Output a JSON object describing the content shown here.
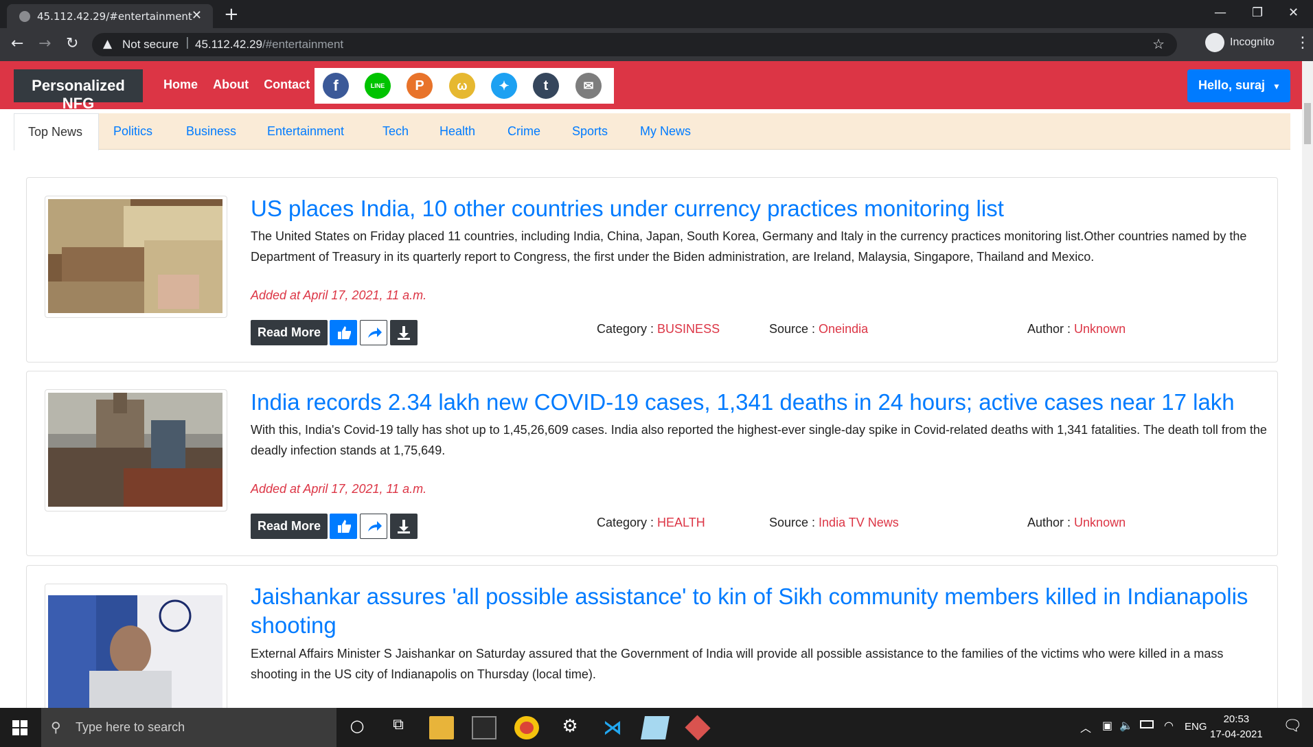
{
  "browser": {
    "tab_title": "45.112.42.29/#entertainment",
    "security_text": "Not secure",
    "url_host": "45.112.42.29",
    "url_path": "/#entertainment",
    "profile_label": "Incognito"
  },
  "navbar": {
    "brand": "Personalized NFG",
    "links": [
      "Home",
      "About",
      "Contact"
    ],
    "share_icons": [
      {
        "name": "facebook-icon",
        "glyph": "f",
        "color": "#3b5998"
      },
      {
        "name": "line-icon",
        "glyph": "LINE",
        "color": "#00c300"
      },
      {
        "name": "pinterest-icon",
        "glyph": "P",
        "color": "#e8732a"
      },
      {
        "name": "weibo-icon",
        "glyph": "w",
        "color": "#e6b830"
      },
      {
        "name": "twitter-icon",
        "glyph": "t",
        "color": "#1da1f2"
      },
      {
        "name": "tumblr-icon",
        "glyph": "t",
        "color": "#35465c"
      },
      {
        "name": "email-icon",
        "glyph": "✉",
        "color": "#7d7d7d"
      }
    ],
    "user_button": "Hello, suraj"
  },
  "categories": [
    "Top News",
    "Politics",
    "Business",
    "Entertainment",
    "Tech",
    "Health",
    "Crime",
    "Sports",
    "My News"
  ],
  "articles": [
    {
      "title": "US places India, 10 other countries under currency practices monitoring list",
      "description": "The United States on Friday placed 11 countries, including India, China, Japan, South Korea, Germany and Italy in the currency practices monitoring list.Other countries named by the Department of Treasury in its quarterly report to Congress, the first under the Biden administration, are Ireland, Malaysia, Singapore, Thailand and Mexico.",
      "added": "Added at April 17, 2021, 11 a.m.",
      "category": "BUSINESS",
      "source": "Oneindia",
      "author": "Unknown"
    },
    {
      "title": "India records 2.34 lakh new COVID-19 cases, 1,341 deaths in 24 hours; active cases near 17 lakh",
      "description": "With this, India's Covid-19 tally has shot up to 1,45,26,609 cases. India also reported the highest-ever single-day spike in Covid-related deaths with 1,341 fatalities. The death toll from the deadly infection stands at 1,75,649.",
      "added": "Added at April 17, 2021, 11 a.m.",
      "category": "HEALTH",
      "source": "India TV News",
      "author": "Unknown"
    },
    {
      "title": "Jaishankar assures 'all possible assistance' to kin of Sikh community members killed in Indianapolis shooting",
      "description": "External Affairs Minister S Jaishankar on Saturday assured that the Government of India will provide all possible assistance to the families of the victims who were killed in a mass shooting in the US city of Indianapolis on Thursday (local time)."
    }
  ],
  "labels": {
    "read_more": "Read More",
    "category": "Category : ",
    "source": "Source : ",
    "author": "Author : "
  },
  "taskbar": {
    "search_placeholder": "Type here to search",
    "language": "ENG",
    "time": "20:53",
    "date": "17-04-2021"
  }
}
